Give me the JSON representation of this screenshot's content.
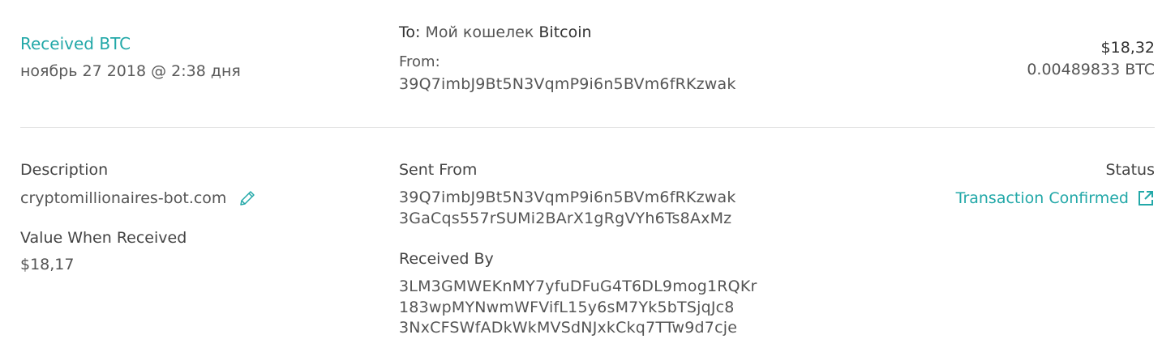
{
  "transaction": {
    "title": "Received BTC",
    "date": "ноябрь 27 2018 @ 2:38 дня",
    "to_label": "To:",
    "to_wallet_prefix": "Мой кошелек",
    "to_wallet_coin": "Bitcoin",
    "from_label": "From:",
    "from_address": "39Q7imbJ9Bt5N3VqmP9i6n5BVm6fRKzwak",
    "amount_usd": "$18,32",
    "amount_btc": "0.00489833 BTC"
  },
  "details": {
    "description_label": "Description",
    "description_value": "cryptomillionaires-bot.com",
    "value_when_received_label": "Value When Received",
    "value_when_received": "$18,17",
    "sent_from_label": "Sent From",
    "sent_from_addresses": [
      "39Q7imbJ9Bt5N3VqmP9i6n5BVm6fRKzwak",
      "3GaCqs557rSUMi2BArX1gRgVYh6Ts8AxMz"
    ],
    "received_by_label": "Received By",
    "received_by_addresses": [
      "3LM3GMWEKnMY7yfuDFuG4T6DL9mog1RQKr",
      "183wpMYNwmWFVifL15y6sM7Yk5bTSjqJc8",
      "3NxCFSWfADkWkMVSdNJxkCkq7TTw9d7cje"
    ],
    "status_label": "Status",
    "status_value": "Transaction Confirmed"
  },
  "icons": {
    "edit": "pencil-icon",
    "external": "external-link-icon"
  },
  "colors": {
    "accent": "#22a8a8",
    "divider": "#e3e3e3"
  }
}
